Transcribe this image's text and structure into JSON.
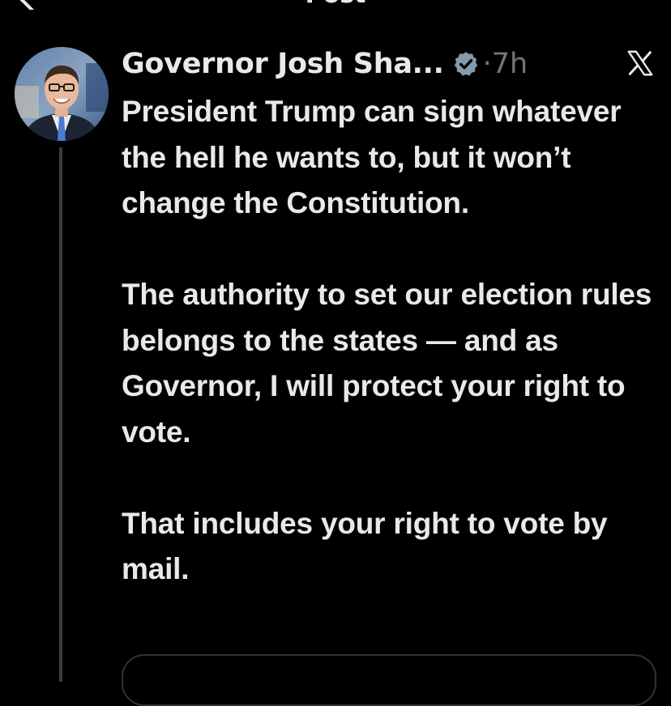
{
  "page": {
    "title": "Post"
  },
  "tweet": {
    "author_name": "Governor Josh Sha...",
    "separator": "·",
    "time": "7h",
    "paragraphs": [
      "President Trump can sign whatever the hell he wants to, but it won’t change the Constitution.",
      "The authority to set our election rules belongs to the states — and as Governor, I will protect your right to vote.",
      "That includes your right to vote by mail."
    ]
  },
  "icons": {
    "back": "back-arrow-icon",
    "verified": "verified-badge-icon",
    "brand": "x-logo-icon"
  },
  "colors": {
    "background": "#000000",
    "text": "#e7e9ea",
    "muted": "#71767b",
    "verified_badge": "#829aab",
    "thread_line": "#3a3d42"
  }
}
